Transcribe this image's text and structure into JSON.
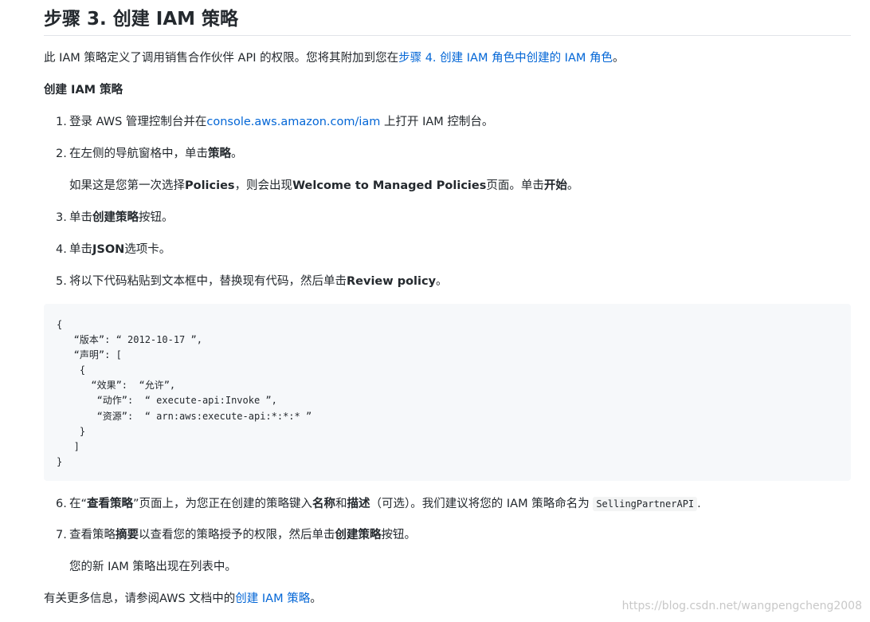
{
  "heading": "步骤 3. 创建 IAM 策略",
  "intro": {
    "text": "此 IAM 策略定义了调用销售合作伙伴 API 的权限。您将其附加到您在",
    "link": "步骤 4. 创建 IAM 角色中创建的 IAM 角色",
    "suffix": "。"
  },
  "subheading": "创建 IAM 策略",
  "steps": {
    "s1": {
      "num": "1.",
      "pre": "登录 AWS 管理控制台并在",
      "link": "console.aws.amazon.com/iam",
      "post": " 上打开 IAM 控制台。"
    },
    "s2": {
      "num": "2.",
      "pre": "在左侧的导航窗格中，单击",
      "bold": "策略",
      "post": "。"
    },
    "s2_note": {
      "pre": "如果这是您第一次选择",
      "bold1": "Policies",
      "mid": "，则会出现",
      "bold2": "Welcome to Managed Policies",
      "mid2": "页面。单击",
      "bold3": "开始",
      "post": "。"
    },
    "s3": {
      "num": "3.",
      "pre": "单击",
      "bold": "创建策略",
      "post": "按钮。"
    },
    "s4": {
      "num": "4.",
      "pre": "单击",
      "bold": "JSON",
      "post": "选项卡。"
    },
    "s5": {
      "num": "5.",
      "pre": "将以下代码粘贴到文本框中，替换现有代码，然后单击",
      "bold": "Review policy",
      "post": "。"
    },
    "s6": {
      "num": "6.",
      "pre": "在“",
      "bold1": "查看策略",
      "mid": "”页面上，为您正在创建的策略键入",
      "bold2": "名称",
      "and": "和",
      "bold3": "描述",
      "mid2": "（可选）。我们建议将您的 IAM 策略命名为 ",
      "code": "SellingPartnerAPI",
      "post": "."
    },
    "s7": {
      "num": "7.",
      "pre": "查看策略",
      "bold1": "摘要",
      "mid": "以查看您的策略授予的权限，然后单击",
      "bold2": "创建策略",
      "post": "按钮。"
    },
    "s7_note": "您的新 IAM 策略出现在列表中。"
  },
  "code_block": "{\n   “版本”: “ 2012-10-17 ”,\n   “声明”: [\n    {\n      “效果”:  “允许”,\n       “动作”:  “ execute-api:Invoke ”,\n       “资源”:  “ arn:aws:execute-api:*:*:* ”\n    }\n   ]\n}",
  "footer": {
    "pre": "有关更多信息，请参阅AWS 文档中的",
    "link": "创建 IAM 策略",
    "post": "。"
  },
  "watermark": "https://blog.csdn.net/wangpengcheng2008",
  "colors": {
    "link": "#0366d6",
    "code_bg": "#f6f8fa",
    "text": "#24292e"
  }
}
